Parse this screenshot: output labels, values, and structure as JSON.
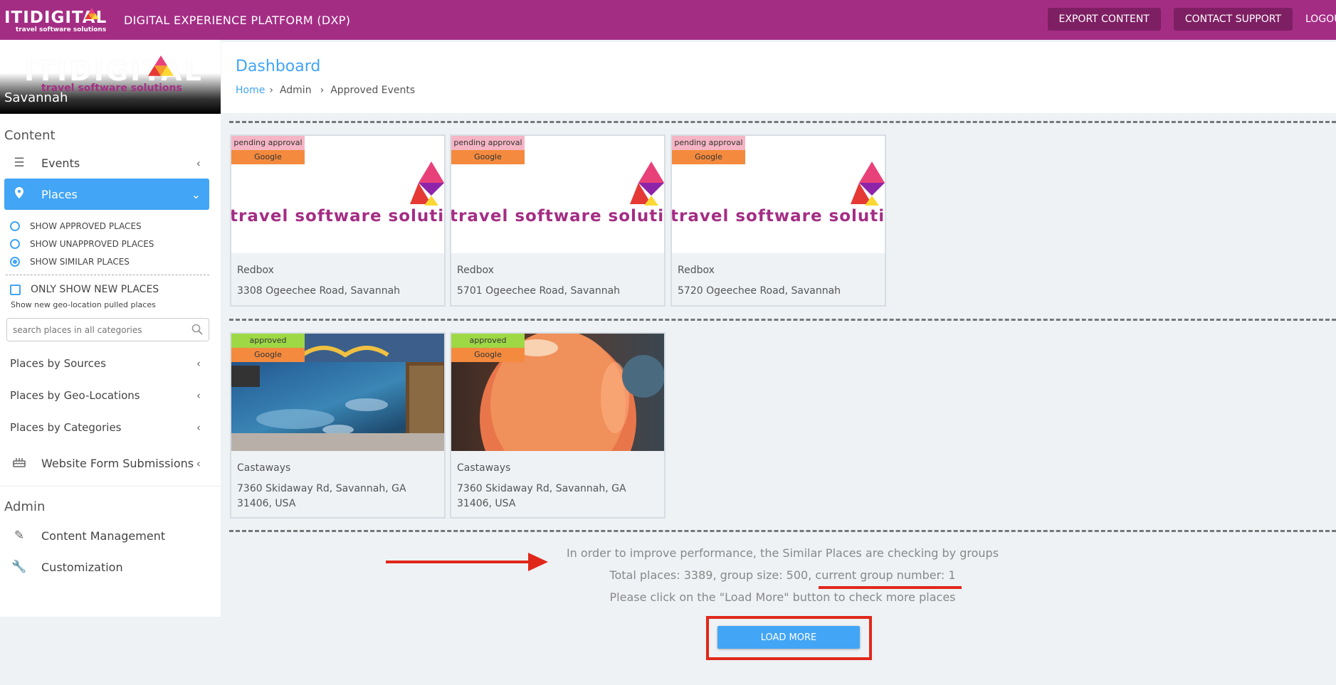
{
  "topbar": {
    "logo_word": "ITIDIGITAL",
    "logo_sub": "travel software solutions",
    "app_title": "DIGITAL EXPERIENCE PLATFORM (DXP)",
    "export_label": "EXPORT CONTENT",
    "support_label": "CONTACT SUPPORT",
    "logout_label": "LOGOUT"
  },
  "sidebar": {
    "logo_word": "ITIDIGITAL",
    "logo_sub": "travel software solutions",
    "city": "Savannah",
    "content_title": "Content",
    "events_label": "Events",
    "places_label": "Places",
    "radio_options": [
      {
        "label": "SHOW APPROVED PLACES",
        "selected": false
      },
      {
        "label": "SHOW UNAPPROVED PLACES",
        "selected": false
      },
      {
        "label": "SHOW SIMILAR PLACES",
        "selected": true
      }
    ],
    "only_new_label": "ONLY SHOW NEW PLACES",
    "only_new_hint": "Show new geo-location pulled places",
    "search_placeholder": "search places in all categories",
    "groups": [
      "Places by Sources",
      "Places by Geo-Locations",
      "Places by Categories"
    ],
    "forms_label": "Website Form Submissions",
    "admin_title": "Admin",
    "content_mgmt_label": "Content Management",
    "customization_label": "Customization"
  },
  "header": {
    "title": "Dashboard",
    "breadcrumb": [
      "Home",
      "Admin",
      "Approved Events"
    ]
  },
  "cards": [
    {
      "status": "pending approval",
      "source": "Google",
      "name": "Redbox",
      "address": "3308 Ogeechee Road, Savannah",
      "placeholder_text": "travel software solutions"
    },
    {
      "status": "pending approval",
      "source": "Google",
      "name": "Redbox",
      "address": "5701 Ogeechee Road, Savannah",
      "placeholder_text": "travel software solutions"
    },
    {
      "status": "pending approval",
      "source": "Google",
      "name": "Redbox",
      "address": "5720 Ogeechee Road, Savannah",
      "placeholder_text": "travel software solutions"
    },
    {
      "status": "approved",
      "source": "Google",
      "name": "Castaways",
      "address": "7360 Skidaway Rd, Savannah, GA 31406, USA"
    },
    {
      "status": "approved",
      "source": "Google",
      "name": "Castaways",
      "address": "7360 Skidaway Rd, Savannah, GA 31406, USA"
    }
  ],
  "performance": {
    "line1": "In order to improve performance, the Similar Places are checking by groups",
    "line2": "Total places: 3389, group size: 500, current group number: 1",
    "line3": "Please click on the \"Load More\" button to check more places",
    "load_more_label": "LOAD MORE"
  },
  "colors": {
    "brand": "#a42d84",
    "accent": "#42a5f5",
    "annotation": "#e0281a"
  }
}
